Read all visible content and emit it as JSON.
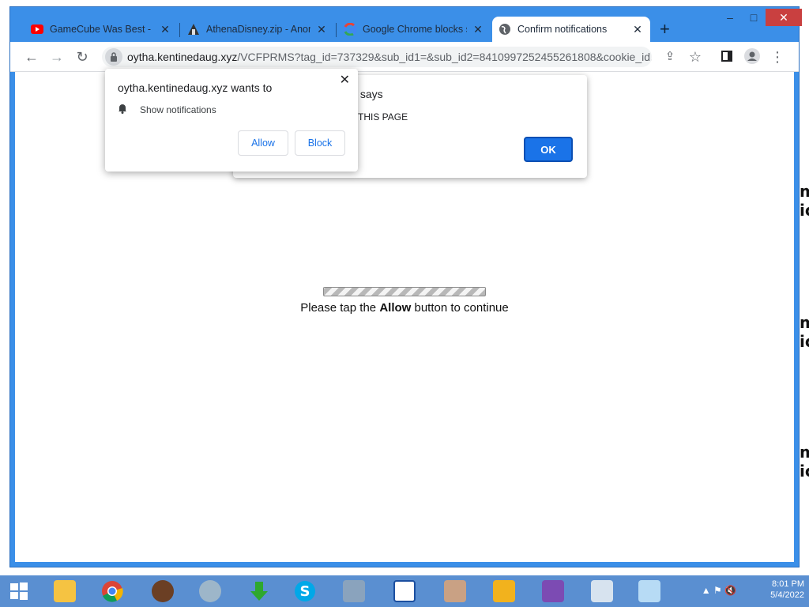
{
  "window": {
    "tabs": [
      {
        "title": "GameCube Was Best - Sc",
        "icon": "youtube-icon",
        "active": false
      },
      {
        "title": "AthenaDisney.zip - Anon",
        "icon": "anonfiles-icon",
        "active": false
      },
      {
        "title": "Google Chrome blocks s",
        "icon": "google-icon",
        "active": false
      },
      {
        "title": "Confirm notifications",
        "icon": "globe-icon",
        "active": true
      }
    ],
    "new_tab_label": "+",
    "controls": {
      "minimize": "–",
      "maximize": "□",
      "close": "✕"
    }
  },
  "toolbar": {
    "url_host": "oytha.kentinedaug.xyz",
    "url_path": "/VCFPRMS?tag_id=737329&sub_id1=&sub_id2=8410997252455261808&cookie_id..."
  },
  "page": {
    "message_before": "Please tap the ",
    "message_bold": "Allow",
    "message_after": " button to continue"
  },
  "alert_dialog": {
    "title": "z says",
    "body": "THIS PAGE",
    "ok_label": "OK"
  },
  "permission_popup": {
    "title": "oytha.kentinedaug.xyz wants to",
    "permission": "Show notifications",
    "allow_label": "Allow",
    "block_label": "Block"
  },
  "desktop": {
    "overlay_text": [
      "download.com/wario/windows?",
      "download.com/wario/windows?",
      "download.com"
    ]
  },
  "taskbar": {
    "time": "8:01 PM",
    "date": "5/4/2022"
  },
  "colors": {
    "chrome_frame": "#3b8fe8",
    "accent_blue": "#1a73e8",
    "taskbar": "#5a8fd1"
  }
}
